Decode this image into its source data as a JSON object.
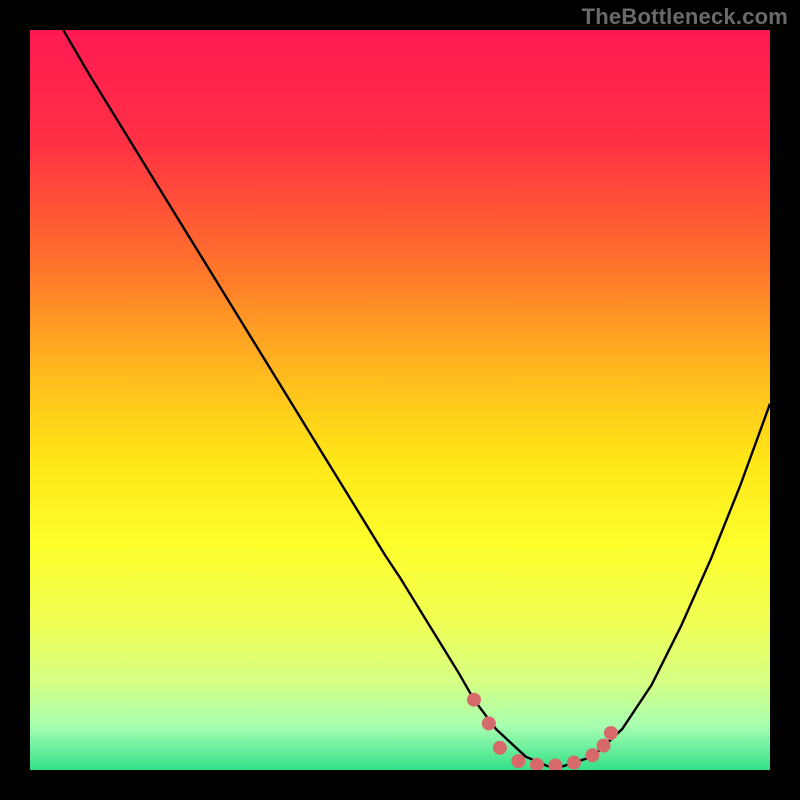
{
  "watermark": "TheBottleneck.com",
  "chart_data": {
    "type": "line",
    "title": "",
    "xlabel": "",
    "ylabel": "",
    "xlim": [
      0,
      100
    ],
    "ylim": [
      0,
      100
    ],
    "background_gradient": {
      "stops": [
        {
          "pos": 0.0,
          "color": "#ff1a52"
        },
        {
          "pos": 0.15,
          "color": "#ff3044"
        },
        {
          "pos": 0.3,
          "color": "#ff6a2e"
        },
        {
          "pos": 0.45,
          "color": "#ffb41f"
        },
        {
          "pos": 0.58,
          "color": "#ffe617"
        },
        {
          "pos": 0.7,
          "color": "#fdff2d"
        },
        {
          "pos": 0.8,
          "color": "#f0ff55"
        },
        {
          "pos": 0.88,
          "color": "#d6ff83"
        },
        {
          "pos": 0.94,
          "color": "#a8ffb0"
        },
        {
          "pos": 1.0,
          "color": "#33e08a"
        }
      ]
    },
    "series": [
      {
        "name": "bottleneck-curve",
        "color": "#000000",
        "stroke_width": 2.4,
        "x": [
          4.5,
          8,
          12,
          16,
          20,
          24,
          28,
          32,
          36,
          40,
          44,
          48,
          50,
          54,
          58,
          60,
          63,
          67,
          70,
          72,
          76,
          80,
          84,
          88,
          92,
          96,
          100
        ],
        "y": [
          100,
          94,
          87.5,
          81,
          74.5,
          68,
          61.5,
          55,
          48.5,
          42,
          35.5,
          29,
          26,
          19.5,
          13,
          9.5,
          5.5,
          1.8,
          0.5,
          0.5,
          1.8,
          5.5,
          11.5,
          19.5,
          28.5,
          38.5,
          49.5
        ]
      }
    ],
    "markers": {
      "name": "optimal-range-dots",
      "color": "#d66a6a",
      "radius": 7,
      "points": [
        {
          "x": 60.0,
          "y": 9.5
        },
        {
          "x": 62.0,
          "y": 6.3
        },
        {
          "x": 63.5,
          "y": 3.0
        },
        {
          "x": 66.0,
          "y": 1.2
        },
        {
          "x": 68.5,
          "y": 0.7
        },
        {
          "x": 71.0,
          "y": 0.6
        },
        {
          "x": 73.5,
          "y": 1.0
        },
        {
          "x": 76.0,
          "y": 2.0
        },
        {
          "x": 77.5,
          "y": 3.3
        },
        {
          "x": 78.5,
          "y": 5.0
        }
      ]
    }
  }
}
